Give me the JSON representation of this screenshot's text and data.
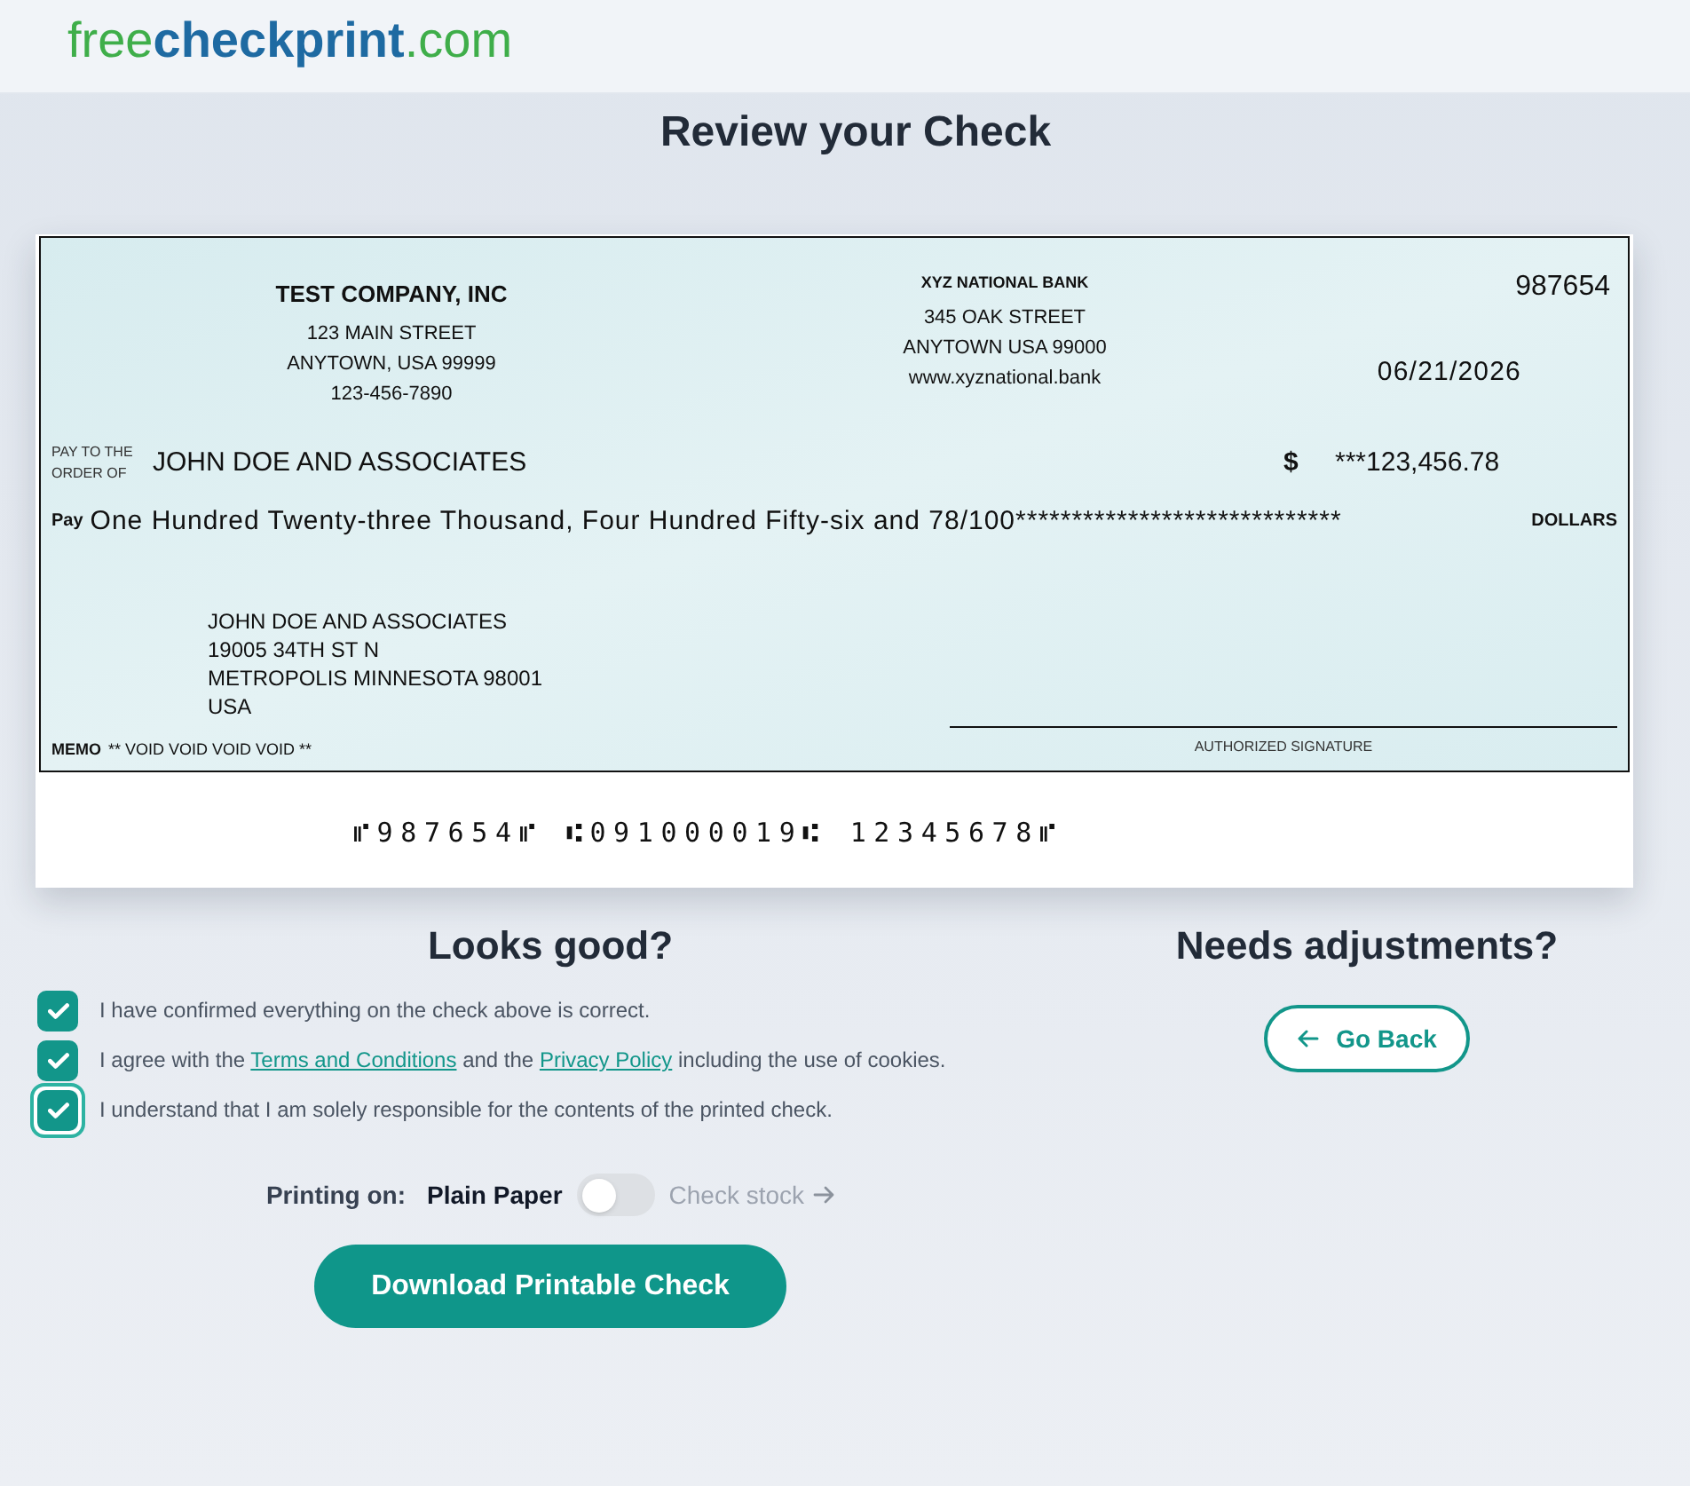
{
  "header": {
    "logo": {
      "prefix": "free",
      "brand": "checkprint",
      "suffix": ".com"
    }
  },
  "page_title": "Review your Check",
  "check": {
    "company": {
      "name": "TEST COMPANY, INC",
      "lines": [
        "123 MAIN STREET",
        "ANYTOWN, USA 99999",
        "123-456-7890"
      ]
    },
    "bank": {
      "name": "XYZ NATIONAL BANK",
      "lines": [
        "345 OAK STREET",
        "ANYTOWN USA 99000",
        "www.xyznational.bank"
      ]
    },
    "check_number": "987654",
    "date": "06/21/2026",
    "payee_label": [
      "PAY TO THE",
      "ORDER OF"
    ],
    "payee": "JOHN DOE AND ASSOCIATES",
    "currency_symbol": "$",
    "amount": "***123,456.78",
    "pay_label": "Pay",
    "amount_words": "One Hundred Twenty-three Thousand, Four Hundred Fifty-six and 78/100*****************************",
    "dollars_label": "DOLLARS",
    "payee_address": [
      "JOHN DOE AND ASSOCIATES",
      "19005 34TH ST N",
      "METROPOLIS MINNESOTA 98001",
      "USA"
    ],
    "memo_label": "MEMO",
    "memo": "** VOID VOID VOID VOID **",
    "signature_label": "AUTHORIZED SIGNATURE",
    "micr_line": "⑈987654⑈ ⑆091000019⑆ 12345678⑈"
  },
  "confirm": {
    "title": "Looks good?",
    "agreements": [
      {
        "segments": [
          {
            "kind": "text",
            "text": "I have confirmed everything on the check above is correct."
          }
        ],
        "checked": true,
        "focused": false
      },
      {
        "segments": [
          {
            "kind": "text",
            "text": "I agree with the "
          },
          {
            "kind": "link",
            "text": "Terms and Conditions"
          },
          {
            "kind": "text",
            "text": " and the "
          },
          {
            "kind": "link",
            "text": "Privacy Policy"
          },
          {
            "kind": "text",
            "text": " including the use of cookies."
          }
        ],
        "checked": true,
        "focused": false
      },
      {
        "segments": [
          {
            "kind": "text",
            "text": "I understand that I am solely responsible for the contents of the printed check."
          }
        ],
        "checked": true,
        "focused": true
      }
    ],
    "printing": {
      "label": "Printing on:",
      "options": [
        "Plain Paper",
        "Check stock"
      ],
      "on": false
    },
    "download_button": "Download Printable Check"
  },
  "adjust": {
    "title": "Needs adjustments?",
    "back_button": "Go Back"
  }
}
